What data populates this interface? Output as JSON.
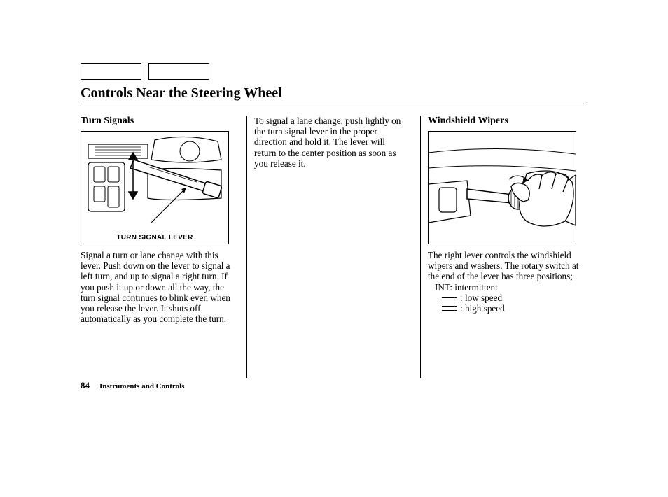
{
  "title": "Controls Near the Steering Wheel",
  "col1": {
    "heading": "Turn Signals",
    "figure_caption": "TURN SIGNAL LEVER",
    "body": "Signal a turn or lane change with this lever. Push down on the lever to signal a left turn, and up to signal a right turn. If you push it up or down all the way, the turn signal continues to blink even when you release the lever. It shuts off automatically as you complete the turn."
  },
  "col2": {
    "body": "To signal a lane change, push lightly on the turn signal lever in the proper direction and hold it. The lever will return to the center position as soon as you release it."
  },
  "col3": {
    "heading": "Windshield Wipers",
    "body1": "The right lever controls the wind­shield wipers and washers. The rotary switch at the end of the lever has three positions;",
    "int_line": "INT: intermittent",
    "low_line": ": low speed",
    "high_line": ": high speed"
  },
  "footer": {
    "page": "84",
    "chapter": "Instruments and Controls"
  }
}
